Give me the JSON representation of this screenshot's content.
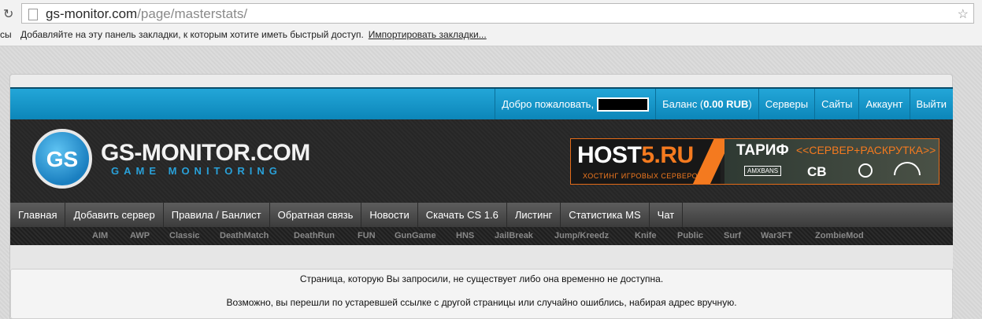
{
  "browser": {
    "url_host": "gs-monitor.com",
    "url_path": "/page/masterstats/",
    "bookmarks_cut": "сы",
    "bookmarks_message": "Добавляйте на эту панель закладки, к которым хотите иметь быстрый доступ.",
    "bookmarks_import": "Импортировать закладки..."
  },
  "topbar": {
    "welcome": "Добро пожаловать,",
    "balance_label": "Баланс (",
    "balance_value": "0.00 RUB",
    "balance_close": ")",
    "links": [
      "Серверы",
      "Сайты",
      "Аккаунт",
      "Выйти"
    ]
  },
  "logo": {
    "badge": "GS",
    "title": "GS-MONITOR.COM",
    "subtitle": "GAME MONITORING"
  },
  "ad": {
    "host_white": "HOST",
    "host_orange": "5.RU",
    "tagline": "ХОСТИНГ ИГРОВЫХ СЕРВЕРОВ",
    "tarif": "ТАРИФ",
    "package": "<<СЕРВЕР+РАСКРУТКА>>",
    "amx": "AMXBANS",
    "cb": "CB"
  },
  "nav": [
    "Главная",
    "Добавить сервер",
    "Правила / Банлист",
    "Обратная связь",
    "Новости",
    "Скачать CS 1.6",
    "Листинг",
    "Статистика MS",
    "Чат"
  ],
  "tags": [
    "AIM",
    "AWP",
    "Classic",
    "DeathMatch",
    "DeathRun",
    "FUN",
    "GunGame",
    "HNS",
    "JailBreak",
    "Jump/Kreedz",
    "Knife",
    "Public",
    "Surf",
    "War3FT",
    "ZombieMod"
  ],
  "message": {
    "line1": "Страница, которую Вы запросили, не существует либо она временно не доступна.",
    "line2": "Возможно, вы перешли по устаревшей ссылке с другой страницы или случайно ошиблись, набирая адрес вручную."
  }
}
